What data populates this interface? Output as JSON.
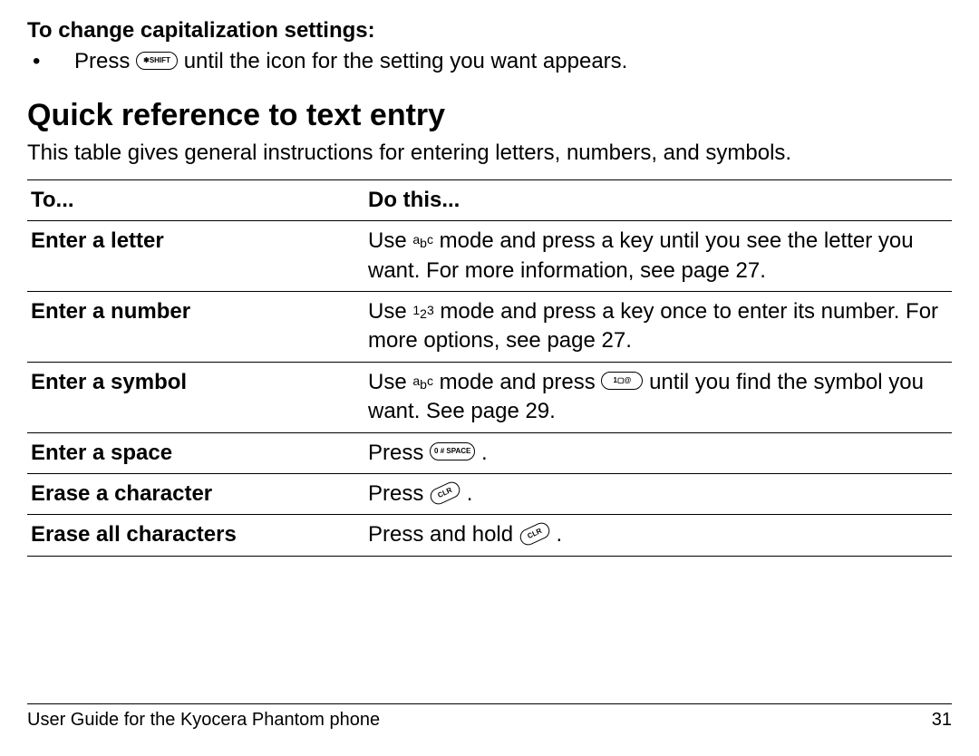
{
  "capitalization": {
    "heading": "To change capitalization settings:",
    "bullet_prefix": "Press ",
    "bullet_suffix": " until the icon for the setting you want appears.",
    "shift_key_label": "✱SHIFT"
  },
  "quickref": {
    "heading": "Quick reference to text entry",
    "intro": "This table gives general instructions for entering letters, numbers, and symbols.",
    "header_to": "To...",
    "header_do": "Do this..."
  },
  "mode_labels": {
    "abc_a": "a",
    "abc_b": "b",
    "abc_c": "c",
    "num_1": "1",
    "num_2": "2",
    "num_3": "3"
  },
  "key_labels": {
    "one_key": "1▢@",
    "space_key": "0 # SPACE",
    "clr_key": "CLR"
  },
  "rows": {
    "letter": {
      "to": "Enter a letter",
      "do_prefix": "Use ",
      "do_suffix": " mode and press a key until you see the letter you want. For more information, see page 27."
    },
    "number": {
      "to": "Enter a number",
      "do_prefix": "Use ",
      "do_suffix": " mode and press a key once to enter its number. For more options, see page 27."
    },
    "symbol": {
      "to": "Enter a symbol",
      "do_prefix": "Use ",
      "do_mid": " mode and press ",
      "do_suffix": " until you find the symbol you want. See page 29."
    },
    "space": {
      "to": "Enter a space",
      "do_prefix": "Press ",
      "do_suffix": " ."
    },
    "erase_one": {
      "to": "Erase a character",
      "do_prefix": "Press ",
      "do_suffix": " ."
    },
    "erase_all": {
      "to": "Erase all characters",
      "do_prefix": "Press and hold ",
      "do_suffix": " ."
    }
  },
  "footer": {
    "title": "User Guide for the Kyocera Phantom phone",
    "page": "31"
  },
  "chart_data": {
    "type": "table",
    "title": "Quick reference to text entry",
    "columns": [
      "To...",
      "Do this..."
    ],
    "rows": [
      [
        "Enter a letter",
        "Use abc mode and press a key until you see the letter you want. For more information, see page 27."
      ],
      [
        "Enter a number",
        "Use 123 mode and press a key once to enter its number. For more options, see page 27."
      ],
      [
        "Enter a symbol",
        "Use abc mode and press [1@] until you find the symbol you want. See page 29."
      ],
      [
        "Enter a space",
        "Press [0 # SPACE]."
      ],
      [
        "Erase a character",
        "Press [CLR]."
      ],
      [
        "Erase all characters",
        "Press and hold [CLR]."
      ]
    ]
  }
}
